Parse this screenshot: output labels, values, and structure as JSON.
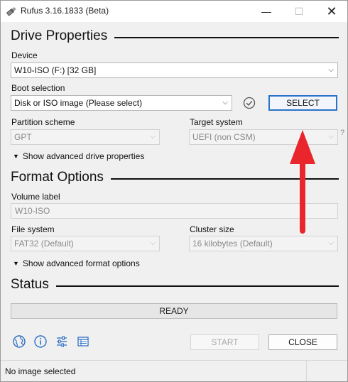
{
  "window": {
    "title": "Rufus 3.16.1833 (Beta)",
    "minimize_glyph": "—",
    "maximize_glyph": "☐",
    "close_glyph": "✕"
  },
  "drive_properties": {
    "heading": "Drive Properties",
    "device_label": "Device",
    "device_value": "W10-ISO (F:) [32 GB]",
    "boot_label": "Boot selection",
    "boot_value": "Disk or ISO image (Please select)",
    "select_button": "SELECT",
    "partition_label": "Partition scheme",
    "partition_value": "GPT",
    "target_label": "Target system",
    "target_value": "UEFI (non CSM)",
    "target_help": "?",
    "advanced_toggle": "Show advanced drive properties"
  },
  "format_options": {
    "heading": "Format Options",
    "volume_label": "Volume label",
    "volume_value": "W10-ISO",
    "filesystem_label": "File system",
    "filesystem_value": "FAT32 (Default)",
    "cluster_label": "Cluster size",
    "cluster_value": "16 kilobytes (Default)",
    "advanced_toggle": "Show advanced format options"
  },
  "status": {
    "heading": "Status",
    "progress_text": "READY"
  },
  "actions": {
    "start_button": "START",
    "close_button": "CLOSE"
  },
  "toolbar_icons": [
    "globe-icon",
    "info-icon",
    "settings-sliders-icon",
    "log-icon"
  ],
  "footer": {
    "message": "No image selected"
  },
  "colors": {
    "accent_focus": "#2b73c9",
    "annotation_arrow": "#e8262b"
  }
}
